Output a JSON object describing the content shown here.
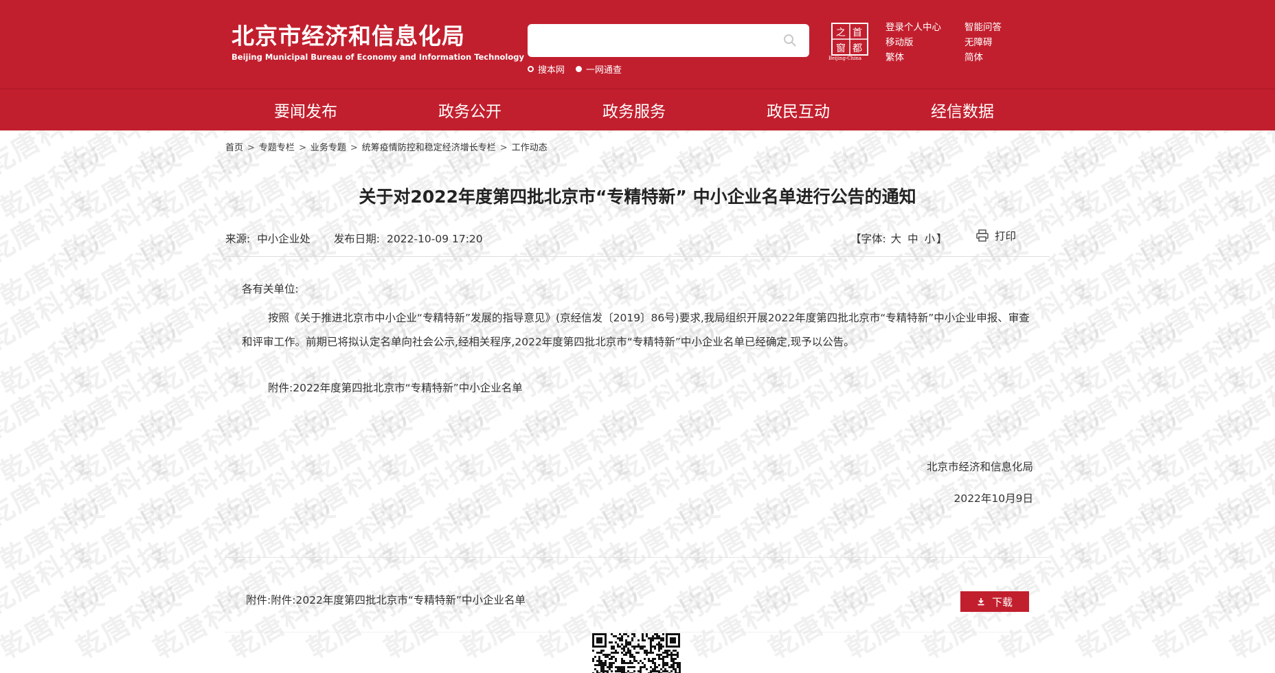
{
  "header": {
    "logo_cn": "北京市经济和信息化局",
    "logo_en": "Beijing Municipal Bureau of Economy and Information Technology",
    "search_placeholder": "",
    "search_scopes": [
      "搜本网",
      "一网通查"
    ],
    "capital_logo_text": "Beijing-China",
    "capital_logo_chars": [
      "首",
      "都",
      "之",
      "窗"
    ],
    "links": [
      "登录个人中心",
      "智能问答",
      "移动版",
      "无障碍",
      "繁体",
      "简体"
    ],
    "nav": [
      "要闻发布",
      "政务公开",
      "政务服务",
      "政民互动",
      "经信数据"
    ],
    "color_primary": "#c21f2e"
  },
  "breadcrumb": [
    "首页",
    "专题专栏",
    "业务专题",
    "统筹疫情防控和稳定经济增长专栏",
    "工作动态"
  ],
  "article": {
    "title": "关于对2022年度第四批北京市“专精特新” 中小企业名单进行公告的通知",
    "source_label": "来源:",
    "source": "中小企业处",
    "date_label": "发布日期:",
    "date": "2022-10-09 17:20",
    "font_label_open": "【字体:",
    "font_sizes": [
      "大",
      "中",
      "小"
    ],
    "font_label_close": "】",
    "print_label": "打印",
    "salutation": "各有关单位:",
    "paragraph": "按照《关于推进北京市中小企业“专精特新”发展的指导意见》(京经信发〔2019〕86号)要求,我局组织开展2022年度第四批北京市“专精特新”中小企业申报、审查和评审工作。前期已将拟认定名单向社会公示,经相关程序,2022年度第四批北京市“专精特新”中小企业名单已经确定,现予以公告。",
    "attachment_text": "附件:2022年度第四批北京市“专精特新”中小企业名单",
    "sign_org": "北京市经济和信息化局",
    "sign_date": "2022年10月9日"
  },
  "attachments": {
    "label": "附件:",
    "item": "附件:2022年度第四批北京市“专精特新”中小企业名单",
    "download_label": "下载"
  },
  "watermark_text": "乾唐科技"
}
